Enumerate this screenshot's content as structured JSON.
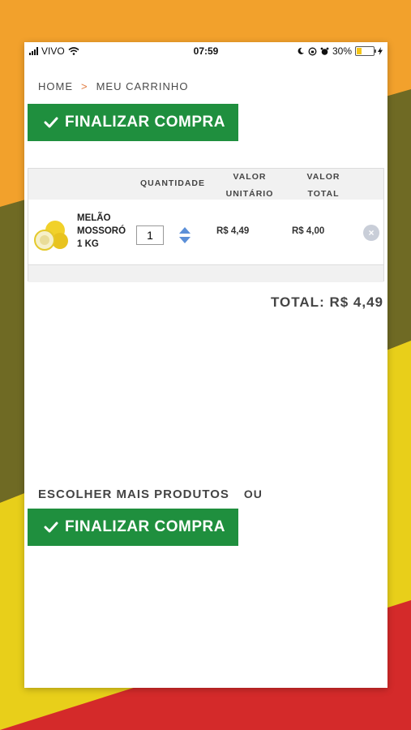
{
  "status_bar": {
    "carrier": "VIVO",
    "time": "07:59",
    "battery": "30%",
    "battery_level": 0.3
  },
  "breadcrumb": {
    "home": "HOME",
    "separator": ">",
    "current": "MEU CARRINHO"
  },
  "buttons": {
    "checkout_label": "FINALIZAR COMPRA"
  },
  "table": {
    "headers": {
      "quantity": "QUANTIDADE",
      "unit_value_line1": "VALOR",
      "unit_value_line2": "UNITÁRIO",
      "total_value_line1": "VALOR",
      "total_value_line2": "TOTAL"
    },
    "items": [
      {
        "name_line1": "MELÃO",
        "name_line2": "MOSSORÓ",
        "name_line3": "1 KG",
        "quantity": "1",
        "unit_price": "R$ 4,49",
        "total_price": "R$ 4,00"
      }
    ]
  },
  "cart_total": "TOTAL: R$ 4,49",
  "footer": {
    "more_products": "ESCOLHER MAIS PRODUTOS",
    "or": "OU"
  },
  "colors": {
    "primary_green": "#1f8f3e",
    "bg_orange": "#f2a12c",
    "bg_olive": "#6f6a24",
    "bg_yellow": "#e8cf1a",
    "bg_red": "#d42a2a"
  }
}
